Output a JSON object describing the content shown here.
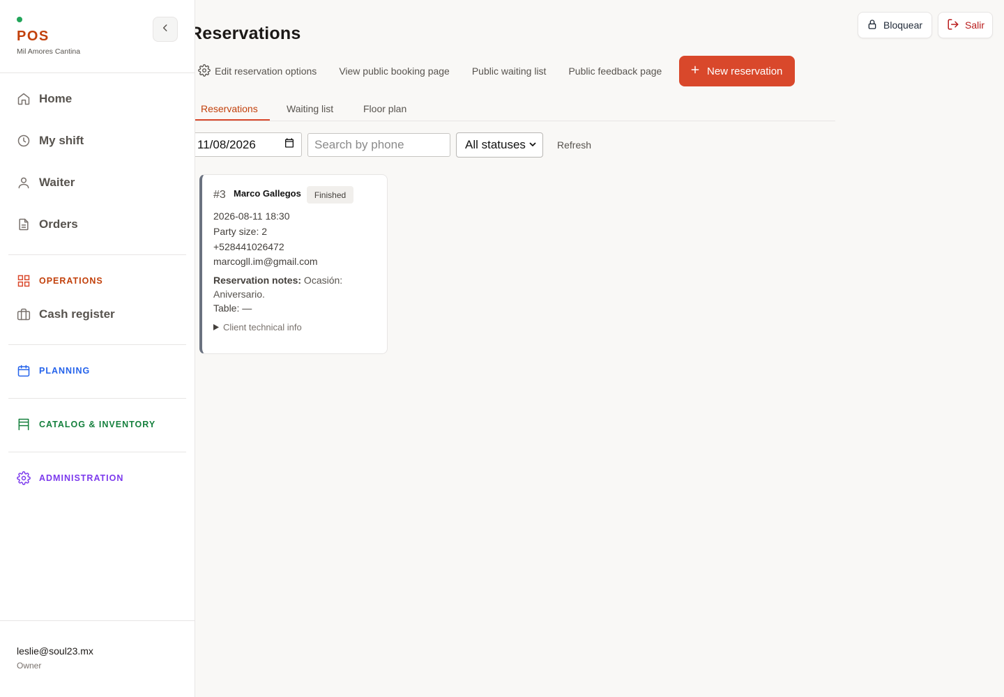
{
  "colors": {
    "accent": "#d9482b",
    "operations": "#c2410c",
    "planning": "#2563eb",
    "catalog": "#15803d",
    "administration": "#7c3aed",
    "online": "#22a55a"
  },
  "header": {
    "title": "Reservations",
    "lock_label": "Bloquear",
    "exit_label": "Salir"
  },
  "actions": {
    "edit_options": "Edit reservation options",
    "public_booking": "View public booking page",
    "waiting_list": "Public waiting list",
    "feedback": "Public feedback page",
    "new_reservation": "New reservation"
  },
  "tabs": [
    "Reservations",
    "Waiting list",
    "Floor plan"
  ],
  "filters": {
    "date": "11/08/2026",
    "search_placeholder": "Search by phone",
    "status": "All statuses",
    "refresh": "Refresh"
  },
  "reservation": {
    "number": "#3",
    "name": "Marco Gallegos",
    "status": "Finished",
    "datetime": "2026-08-11 18:30",
    "party": "Party size: 2",
    "phone": "+528441026472",
    "email": "marcogll.im@gmail.com",
    "notes_label": "Reservation notes:",
    "notes_text": " Ocasión: Aniversario.",
    "table": "Table: —",
    "tech_info": "Client technical info"
  },
  "sidebar": {
    "brand": "POS",
    "subtitle": "Mil Amores Cantina",
    "items": [
      {
        "label": "Home",
        "icon": "home-icon"
      },
      {
        "label": "My shift",
        "icon": "clock-icon"
      },
      {
        "label": "Waiter",
        "icon": "user-icon"
      },
      {
        "label": "Orders",
        "icon": "document-icon"
      }
    ],
    "operations": {
      "label": "OPERATIONS",
      "icon": "grid-icon"
    },
    "cash_register": {
      "label": "Cash register",
      "icon": "briefcase-icon"
    },
    "planning": {
      "label": "PLANNING",
      "icon": "calendar-icon"
    },
    "catalog": {
      "label": "CATALOG & INVENTORY",
      "icon": "layout-icon"
    },
    "administration": {
      "label": "ADMINISTRATION",
      "icon": "gear-icon"
    },
    "user_email": "leslie@soul23.mx",
    "user_role": "Owner"
  }
}
